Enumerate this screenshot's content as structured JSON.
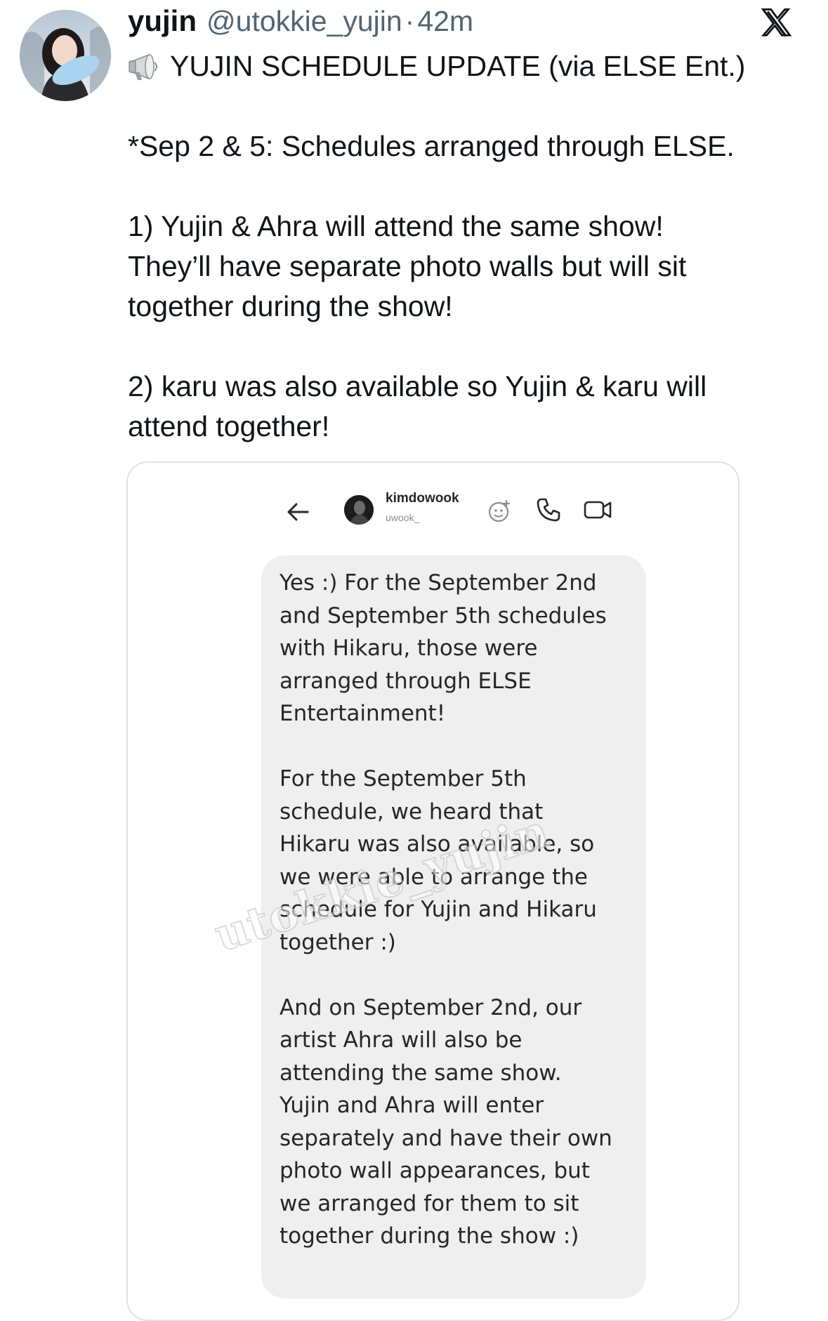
{
  "tweet": {
    "author": {
      "display_name": "yujin",
      "handle": "@utokkie_yujin",
      "separator": "·",
      "time": "42m",
      "avatar_icon": "profile-photo"
    },
    "platform_icon": "x-logo-icon",
    "headline": "YUJIN SCHEDULE UPDATE (via ELSE Ent.)",
    "headline_icon": "megaphone-icon",
    "paragraphs": [
      "*Sep 2 & 5: Schedules arranged through ELSE.",
      "1) Yujin & Ahra will attend the same show!\nThey’ll have separate photo walls but will sit\ntogether during the show!",
      "2) karu was also available so Yujin & karu will\nattend together!"
    ]
  },
  "media": {
    "dm": {
      "username": "kimdowook",
      "subname": "uwook_",
      "icons": [
        "back-arrow-icon",
        "effects-icon",
        "phone-icon",
        "video-camera-icon"
      ],
      "message_paragraphs": [
        "Yes :) For the September 2nd\nand September 5th schedules\nwith Hikaru, those were\narranged through ELSE\nEntertainment!",
        "For the September 5th\nschedule, we heard that\nHikaru was also available, so\nwe were able to arrange the\nschedule for Yujin and Hikaru\ntogether :)",
        "And on September 2nd, our\nartist Ahra will also be\nattending the same show.\nYujin and Ahra will enter\nseparately and have their own\nphoto wall appearances, but\nwe arranged for them to sit\ntogether during the show :)"
      ]
    },
    "watermark": "utokkie_yujin"
  },
  "colors": {
    "text": "#0f1419",
    "secondary_text": "#536471",
    "card_border": "#dfe3e7",
    "bubble": "#efefef",
    "bubble_text": "#262626"
  }
}
